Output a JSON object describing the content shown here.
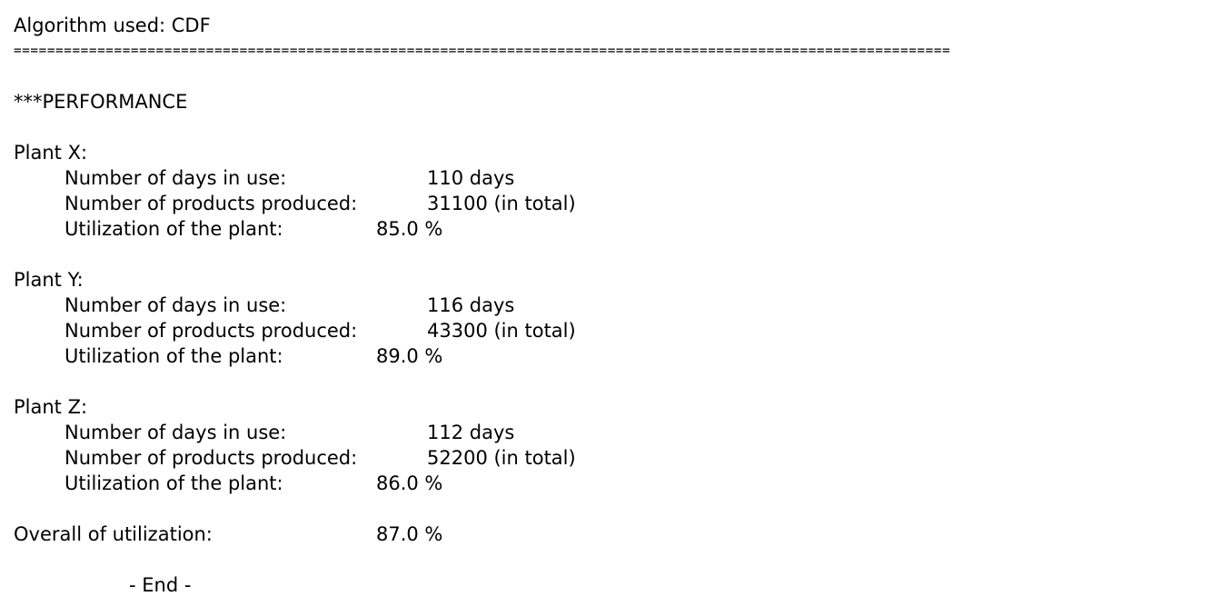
{
  "header": {
    "algorithm_line": "Algorithm used: CDF",
    "separator": "================================================================================================================"
  },
  "section_title": "***PERFORMANCE",
  "plants": [
    {
      "name": "Plant X:",
      "days_label": "Number of days in use:",
      "days_value": "110 days",
      "products_label": "Number of products produced:",
      "products_value": "31100 (in total)",
      "util_label": "Utilization of the plant:",
      "util_value": "85.0 %"
    },
    {
      "name": "Plant Y:",
      "days_label": "Number of days in use:",
      "days_value": "116 days",
      "products_label": "Number of products produced:",
      "products_value": "43300 (in total)",
      "util_label": "Utilization of the plant:",
      "util_value": "89.0 %"
    },
    {
      "name": "Plant Z:",
      "days_label": "Number of days in use:",
      "days_value": "112 days",
      "products_label": "Number of products produced:",
      "products_value": "52200 (in total)",
      "util_label": "Utilization of the plant:",
      "util_value": "86.0 %"
    }
  ],
  "overall": {
    "label": "Overall of utilization:",
    "value": "87.0 %"
  },
  "footer": {
    "end_text": "- End -"
  }
}
